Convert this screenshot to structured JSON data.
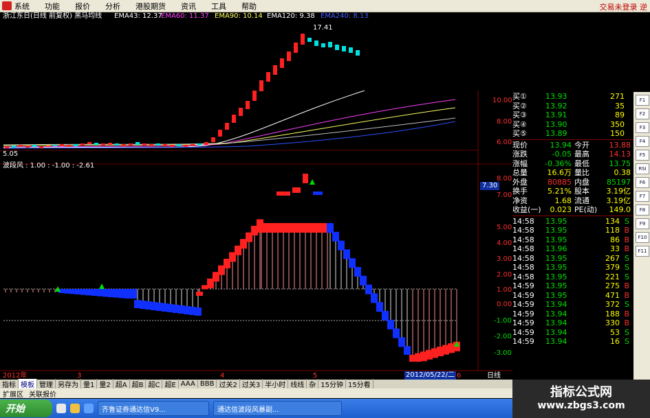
{
  "menu": {
    "items": [
      "系统",
      "功能",
      "报价",
      "分析",
      "港股期货",
      "资讯",
      "工具",
      "帮助"
    ],
    "right_status": "交易未登录 逆"
  },
  "top_indicator": {
    "title": "浙江东日(日线 前复权) 黑马均线",
    "ema43": "EMA43: 12.37",
    "ema60": "EMA60: 11.37",
    "ema90": "EMA90: 10.14",
    "ema120": "EMA120: 9.38",
    "ema240": "EMA240: 8.13",
    "peak_label": "17.41",
    "low_label": "5.05"
  },
  "price_axis": [
    "10.00",
    "8.00",
    "6.00"
  ],
  "lower_indicator": {
    "title": "波段风 : 1.00 : -1.00 : -2.61",
    "current_value": "7.30",
    "axis": [
      "8.00",
      "7.00",
      "5.00",
      "4.00",
      "3.00",
      "2.00",
      "1.00",
      "0.00",
      "-1.00",
      "-2.00",
      "-3.00"
    ]
  },
  "time_axis": {
    "labels": [
      "2012年",
      "3",
      "4",
      "5",
      "2012/05/22/二",
      "6"
    ],
    "period": "日线"
  },
  "quote": {
    "bids": [
      {
        "label": "买①",
        "price": "13.93",
        "vol": "271"
      },
      {
        "label": "买②",
        "price": "13.92",
        "vol": "35"
      },
      {
        "label": "买③",
        "price": "13.91",
        "vol": "89"
      },
      {
        "label": "买④",
        "price": "13.90",
        "vol": "350"
      },
      {
        "label": "买⑤",
        "price": "13.89",
        "vol": "150"
      }
    ],
    "stats": [
      {
        "k1": "现价",
        "v1": "13.94",
        "c1": "#00e000",
        "k2": "今开",
        "v2": "13.88",
        "c2": "#ff3030"
      },
      {
        "k1": "涨跌",
        "v1": "-0.05",
        "c1": "#00e000",
        "k2": "最高",
        "v2": "14.13",
        "c2": "#ff3030"
      },
      {
        "k1": "涨幅",
        "v1": "-0.36%",
        "c1": "#00e000",
        "k2": "最低",
        "v2": "13.75",
        "c2": "#00e000"
      },
      {
        "k1": "总量",
        "v1": "16.6万",
        "c1": "#ffff00",
        "k2": "量比",
        "v2": "0.38",
        "c2": "#ffff00"
      },
      {
        "k1": "外盘",
        "v1": "80885",
        "c1": "#ff3030",
        "k2": "内盘",
        "v2": "85197",
        "c2": "#00e000"
      },
      {
        "k1": "换手",
        "v1": "5.21%",
        "c1": "#ffff00",
        "k2": "股本",
        "v2": "3.19亿",
        "c2": "#ffff00"
      },
      {
        "k1": "净资",
        "v1": "1.68",
        "c1": "#ffff00",
        "k2": "流通",
        "v2": "3.19亿",
        "c2": "#ffff00"
      },
      {
        "k1": "收益(一)",
        "v1": "0.023",
        "c1": "#ffff00",
        "k2": "PE(动)",
        "v2": "149.0",
        "c2": "#ffff00"
      }
    ],
    "ticks": [
      {
        "t": "14:58",
        "p": "13.95",
        "v": "134",
        "s": "S"
      },
      {
        "t": "14:58",
        "p": "13.95",
        "v": "118",
        "s": "B"
      },
      {
        "t": "14:58",
        "p": "13.95",
        "v": "86",
        "s": "B"
      },
      {
        "t": "14:58",
        "p": "13.96",
        "v": "33",
        "s": "B"
      },
      {
        "t": "14:58",
        "p": "13.95",
        "v": "267",
        "s": "S"
      },
      {
        "t": "14:58",
        "p": "13.95",
        "v": "379",
        "s": "S"
      },
      {
        "t": "14:58",
        "p": "13.95",
        "v": "221",
        "s": "S"
      },
      {
        "t": "14:59",
        "p": "13.95",
        "v": "275",
        "s": "B"
      },
      {
        "t": "14:59",
        "p": "13.95",
        "v": "471",
        "s": "B"
      },
      {
        "t": "14:59",
        "p": "13.94",
        "v": "372",
        "s": "S"
      },
      {
        "t": "14:59",
        "p": "13.94",
        "v": "188",
        "s": "B"
      },
      {
        "t": "14:59",
        "p": "13.94",
        "v": "330",
        "s": "B"
      },
      {
        "t": "14:59",
        "p": "13.94",
        "v": "53",
        "s": "S"
      },
      {
        "t": "14:59",
        "p": "13.94",
        "v": "16",
        "s": "S"
      }
    ]
  },
  "side_buttons": [
    "F1",
    "F2",
    "F3",
    "F4",
    "F5",
    "RSI",
    "F6",
    "F7",
    "F8",
    "F9",
    "F10",
    "F11"
  ],
  "tabs": [
    "指标",
    "模板",
    "管理",
    "另存为",
    "量1",
    "量2",
    "超A",
    "超B",
    "超C",
    "超E",
    "AAA",
    "BBB",
    "过关2",
    "过关3",
    "半小时",
    "线线",
    "杂",
    "15分钟",
    "15分看"
  ],
  "bottom_links": [
    "扩展区",
    "关联报价"
  ],
  "taskbar": {
    "start_label": "开始",
    "tasks": [
      "齐鲁证券通达信V9...",
      "通达信波段风暴副..."
    ]
  },
  "watermark": {
    "line1": "指标公式网",
    "line2": "www.zbgs3.com"
  },
  "colors": {
    "up": "#ff2020",
    "down": "#00e0e0",
    "blue_bar": "#1030ff",
    "positive": "#ff3030",
    "negative": "#00e000"
  }
}
